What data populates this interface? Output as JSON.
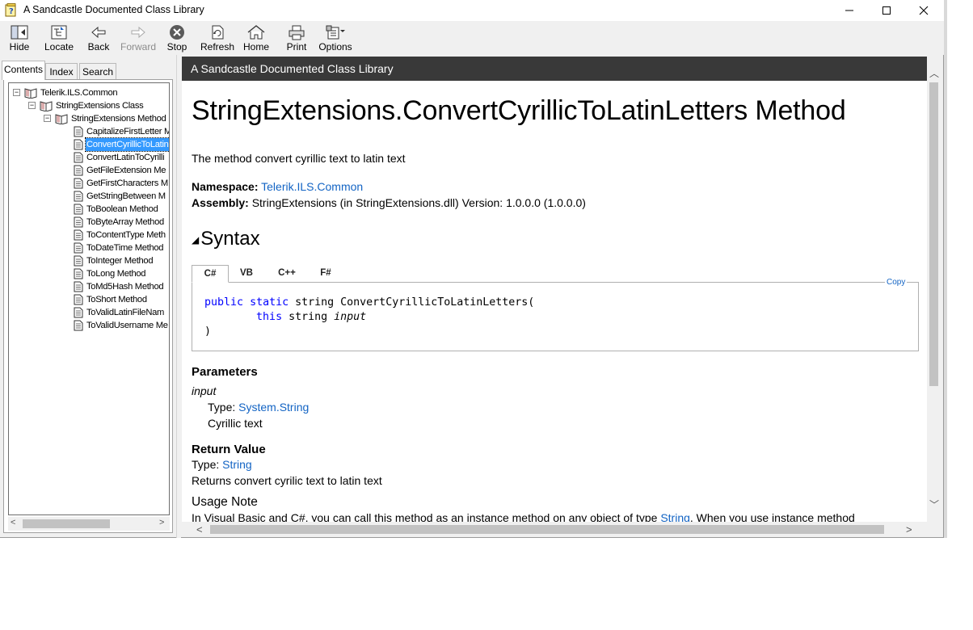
{
  "window": {
    "title": "A Sandcastle Documented Class Library"
  },
  "toolbar": {
    "hide": "Hide",
    "locate": "Locate",
    "back": "Back",
    "forward": "Forward",
    "stop": "Stop",
    "refresh": "Refresh",
    "home": "Home",
    "print": "Print",
    "options": "Options"
  },
  "nav_tabs": {
    "contents": "Contents",
    "index": "Index",
    "search": "Search"
  },
  "tree": {
    "root": "Telerik.ILS.Common",
    "class": "StringExtensions Class",
    "methods": "StringExtensions Method",
    "items": [
      "CapitalizeFirstLetter M",
      "ConvertCyrillicToLatin",
      "ConvertLatinToCyrilli",
      "GetFileExtension Me",
      "GetFirstCharacters M",
      "GetStringBetween M",
      "ToBoolean Method",
      "ToByteArray Method",
      "ToContentType Meth",
      "ToDateTime Method",
      "ToInteger Method",
      "ToLong Method",
      "ToMd5Hash Method",
      "ToShort Method",
      "ToValidLatinFileNam",
      "ToValidUsername Me"
    ],
    "selected_index": 1
  },
  "content": {
    "header": "A Sandcastle Documented Class Library",
    "title": "StringExtensions.ConvertCyrillicToLatinLetters Method",
    "summary": "The method convert cyrillic text to latin text",
    "namespace_label": "Namespace:",
    "namespace_value": "Telerik.ILS.Common",
    "assembly_label": "Assembly:",
    "assembly_value": "StringExtensions (in StringExtensions.dll) Version: 1.0.0.0 (1.0.0.0)",
    "syntax_heading": "Syntax",
    "code_tabs": [
      "C#",
      "VB",
      "C++",
      "F#"
    ],
    "copy_label": "Copy",
    "code": {
      "kw1": "public",
      "kw2": "static",
      "t1": " string ConvertCyrillicToLatinLetters(",
      "kw3": "this",
      "t2": " string ",
      "param": "input",
      "close": ")"
    },
    "parameters_heading": "Parameters",
    "param_name": "input",
    "param_type_label": "Type:",
    "param_type_value": "System.String",
    "param_desc": "Cyrillic text",
    "return_heading": "Return Value",
    "return_type_label": "Type:",
    "return_type_value": "String",
    "return_desc": "Returns convert cyrilic text to latin text",
    "usage_heading": "Usage Note",
    "usage_text_1": "In Visual Basic and C#, you can call this method as an instance method on any object of type ",
    "usage_link": "String",
    "usage_text_2": ". When you use instance method"
  }
}
